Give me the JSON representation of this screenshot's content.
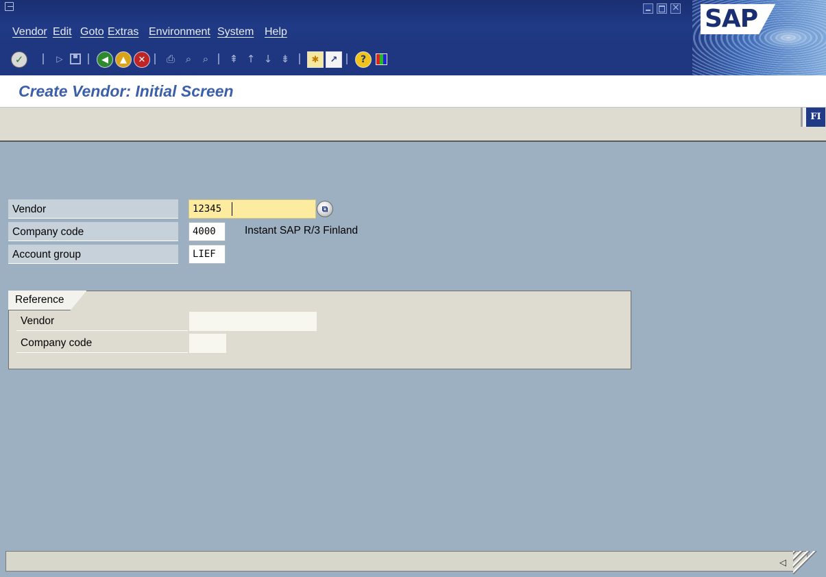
{
  "menu": {
    "items": [
      "Vendor",
      "Edit",
      "Goto",
      "Extras",
      "Environment",
      "System",
      "Help"
    ]
  },
  "logo": {
    "text": "SAP"
  },
  "toolbar": {
    "icons": [
      "enter-icon",
      "command-field-icon",
      "save-icon",
      "back-icon",
      "exit-icon",
      "cancel-icon",
      "print-icon",
      "find-icon",
      "find-next-icon",
      "first-page-icon",
      "previous-page-icon",
      "next-page-icon",
      "last-page-icon",
      "create-session-icon",
      "create-shortcut-icon",
      "help-icon",
      "layout-menu-icon"
    ]
  },
  "title": {
    "text": "Create Vendor: Initial Screen"
  },
  "app_toolbar": {
    "fi_label": "FI"
  },
  "form": {
    "vendor": {
      "label": "Vendor",
      "value": "12345"
    },
    "company_code": {
      "label": "Company code",
      "value": "4000",
      "description": "Instant SAP R/3 Finland"
    },
    "account_group": {
      "label": "Account group",
      "value": "LIEF"
    }
  },
  "reference": {
    "title": "Reference",
    "vendor_label": "Vendor",
    "company_code_label": "Company code",
    "vendor_value": "",
    "company_code_value": ""
  },
  "colors": {
    "menu_bg": "#1e3780",
    "screen_bg": "#9cb0c2",
    "title_color": "#3b5fa8",
    "focused_input": "#fdeba0"
  }
}
